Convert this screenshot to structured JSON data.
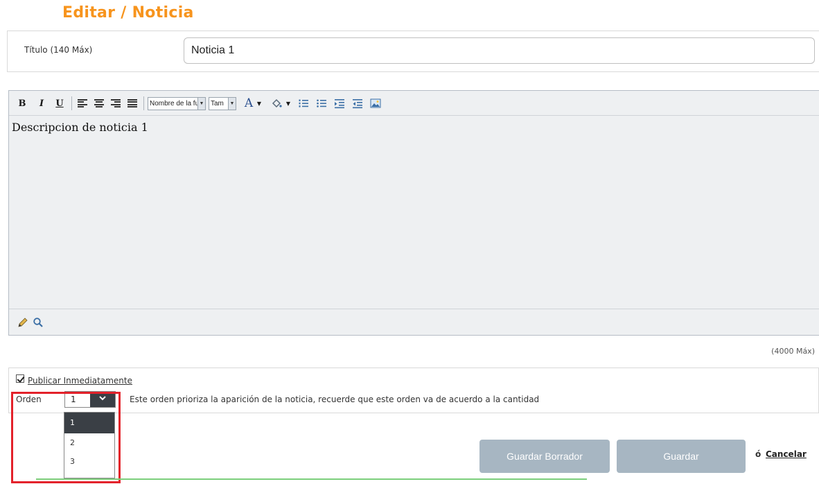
{
  "page": {
    "title": "Editar / Noticia"
  },
  "title_field": {
    "label": "Título (140 Máx)",
    "value": "Noticia 1"
  },
  "editor": {
    "toolbar": {
      "bold": "B",
      "italic": "I",
      "underline": "U",
      "font_name": "Nombre de la fu",
      "font_size": "Tam",
      "font_color": "A"
    },
    "content": "Descripcion de noticia 1",
    "max_label": "(4000 Máx)"
  },
  "publish": {
    "checkbox_label": "Publicar Inmediatamente",
    "checked": true,
    "orden_label": "Orden",
    "orden_value": "1",
    "orden_hint": "Este orden prioriza la aparición de la noticia, recuerde que este orden va de acuerdo a la cantidad",
    "orden_options": [
      "1",
      "2",
      "3"
    ]
  },
  "actions": {
    "save_draft": "Guardar Borrador",
    "save": "Guardar",
    "or": "ó",
    "cancel": "Cancelar"
  },
  "colors": {
    "title": "#f7941d",
    "button": "#a7b6c2",
    "highlight": "#e3212a"
  }
}
